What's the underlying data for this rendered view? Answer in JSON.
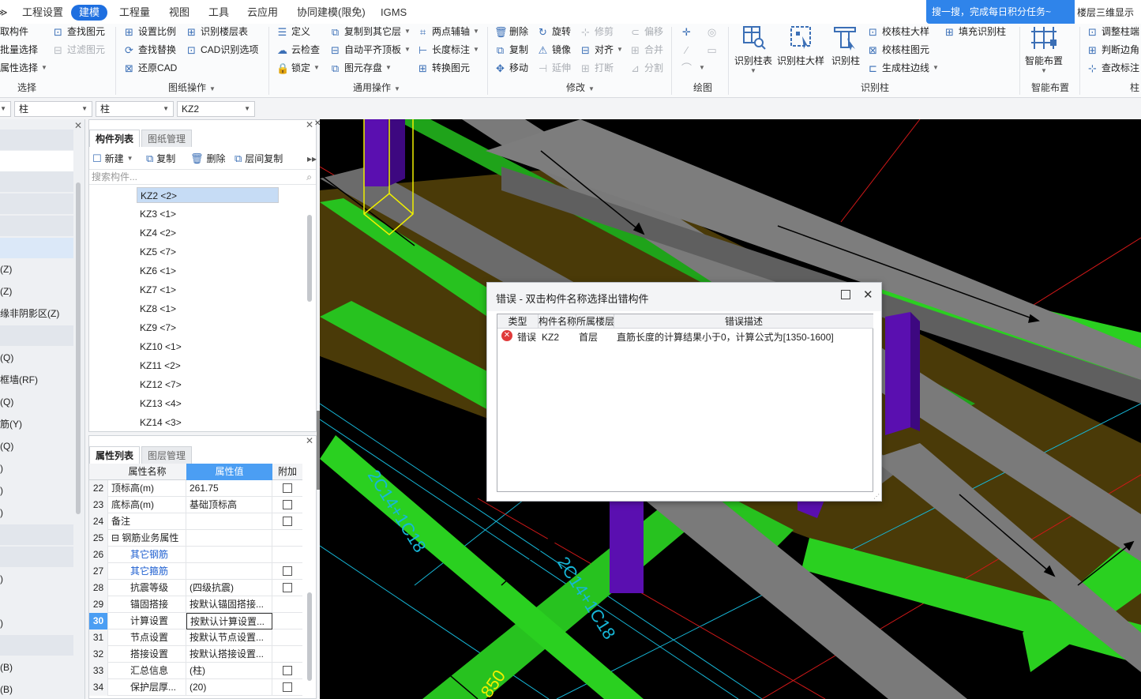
{
  "menu": {
    "items": [
      "工程设置",
      "建模",
      "工程量",
      "视图",
      "工具",
      "云应用",
      "协同建模(限免)",
      "IGMS"
    ],
    "active_index": 1,
    "promo": "搜一搜，完成每日积分任务~",
    "view3d": "楼层三维显示图"
  },
  "ribbon": {
    "select": {
      "items": [
        "取构件",
        "批量选择",
        "属性选择"
      ],
      "label": "选择"
    },
    "find": {
      "items": [
        "查找图元",
        "过滤图元"
      ]
    },
    "drawing": {
      "items": [
        "设置比例",
        "识别楼层表",
        "查找替换",
        "CAD识别选项",
        "还原CAD"
      ],
      "label": "图纸操作"
    },
    "common": {
      "items": [
        "定义",
        "复制到其它层",
        "两点辅轴",
        "云检查",
        "自动平齐顶板",
        "长度标注",
        "锁定",
        "图元存盘",
        "转换图元"
      ],
      "label": "通用操作"
    },
    "modify": {
      "items": [
        "删除",
        "旋转",
        "修剪",
        "偏移",
        "复制",
        "镜像",
        "对齐",
        "合并",
        "移动",
        "延伸",
        "打断",
        "分割"
      ],
      "label": "修改"
    },
    "draw": {
      "label": "绘图"
    },
    "recognize": {
      "big": [
        "识别柱表",
        "识别柱大样",
        "识别柱"
      ],
      "items": [
        "校核柱大样",
        "填充识别柱",
        "校核柱图元",
        "生成柱边线"
      ],
      "label": "识别柱"
    },
    "smart": {
      "big": "智能布置",
      "label": "智能布置"
    },
    "adjust": {
      "items": [
        "调整柱端",
        "判断边角",
        "查改标注"
      ],
      "label": "柱"
    }
  },
  "selectors": [
    "柱",
    "柱",
    "KZ2"
  ],
  "left_panel": {
    "items": [
      "(Z)",
      "(Z)",
      "缘非阴影区(Z)",
      "(Q)",
      "框墙(RF)",
      "(Q)",
      "筋(Y)",
      "(Q)",
      ")",
      ")",
      ")",
      ")",
      ")",
      "(B)",
      "(B)"
    ]
  },
  "component_panel": {
    "tabs": [
      "构件列表",
      "图纸管理"
    ],
    "toolbar": [
      "新建",
      "复制",
      "删除",
      "层间复制"
    ],
    "search_placeholder": "搜索构件...",
    "items": [
      "KZ2 <2>",
      "KZ3 <1>",
      "KZ4 <2>",
      "KZ5 <7>",
      "KZ6 <1>",
      "KZ7 <1>",
      "KZ8 <1>",
      "KZ9 <7>",
      "KZ10 <1>",
      "KZ11 <2>",
      "KZ12 <7>",
      "KZ13 <4>",
      "KZ14 <3>"
    ],
    "selected_index": 0
  },
  "property_panel": {
    "tabs": [
      "属性列表",
      "图层管理"
    ],
    "headers": [
      "属性名称",
      "属性值",
      "附加"
    ],
    "rows": [
      {
        "num": "22",
        "name": "顶标高(m)",
        "value": "261.75",
        "check": true,
        "style": ""
      },
      {
        "num": "23",
        "name": "底标高(m)",
        "value": "基础顶标高",
        "check": true,
        "style": ""
      },
      {
        "num": "24",
        "name": "备注",
        "value": "",
        "check": true,
        "style": ""
      },
      {
        "num": "25",
        "name": "钢筋业务属性",
        "value": "",
        "check": false,
        "style": "group"
      },
      {
        "num": "26",
        "name": "其它钢筋",
        "value": "",
        "check": false,
        "style": "blue"
      },
      {
        "num": "27",
        "name": "其它箍筋",
        "value": "",
        "check": true,
        "style": "blue"
      },
      {
        "num": "28",
        "name": "抗震等级",
        "value": "(四级抗震)",
        "check": true,
        "style": "indent"
      },
      {
        "num": "29",
        "name": "锚固搭接",
        "value": "按默认锚固搭接...",
        "check": false,
        "style": "indent"
      },
      {
        "num": "30",
        "name": "计算设置",
        "value": "按默认计算设置...",
        "check": false,
        "style": "selected"
      },
      {
        "num": "31",
        "name": "节点设置",
        "value": "按默认节点设置...",
        "check": false,
        "style": "indent"
      },
      {
        "num": "32",
        "name": "搭接设置",
        "value": "按默认搭接设置...",
        "check": false,
        "style": "indent"
      },
      {
        "num": "33",
        "name": "汇总信息",
        "value": "(柱)",
        "check": true,
        "style": "indent"
      },
      {
        "num": "34",
        "name": "保护层厚...",
        "value": "(20)",
        "check": true,
        "style": "indent"
      }
    ]
  },
  "viewport": {
    "annotations": [
      "2C14+1C18",
      "2C14+1C18",
      "850"
    ]
  },
  "dialog": {
    "title": "错误 - 双击构件名称选择出错构件",
    "headers": [
      "类型",
      "构件名称",
      "所属楼层",
      "错误描述"
    ],
    "rows": [
      {
        "type": "错误",
        "name": "KZ2",
        "floor": "首层",
        "desc": "直筋长度的计算结果小于0，计算公式为[1350-1600]"
      }
    ]
  }
}
